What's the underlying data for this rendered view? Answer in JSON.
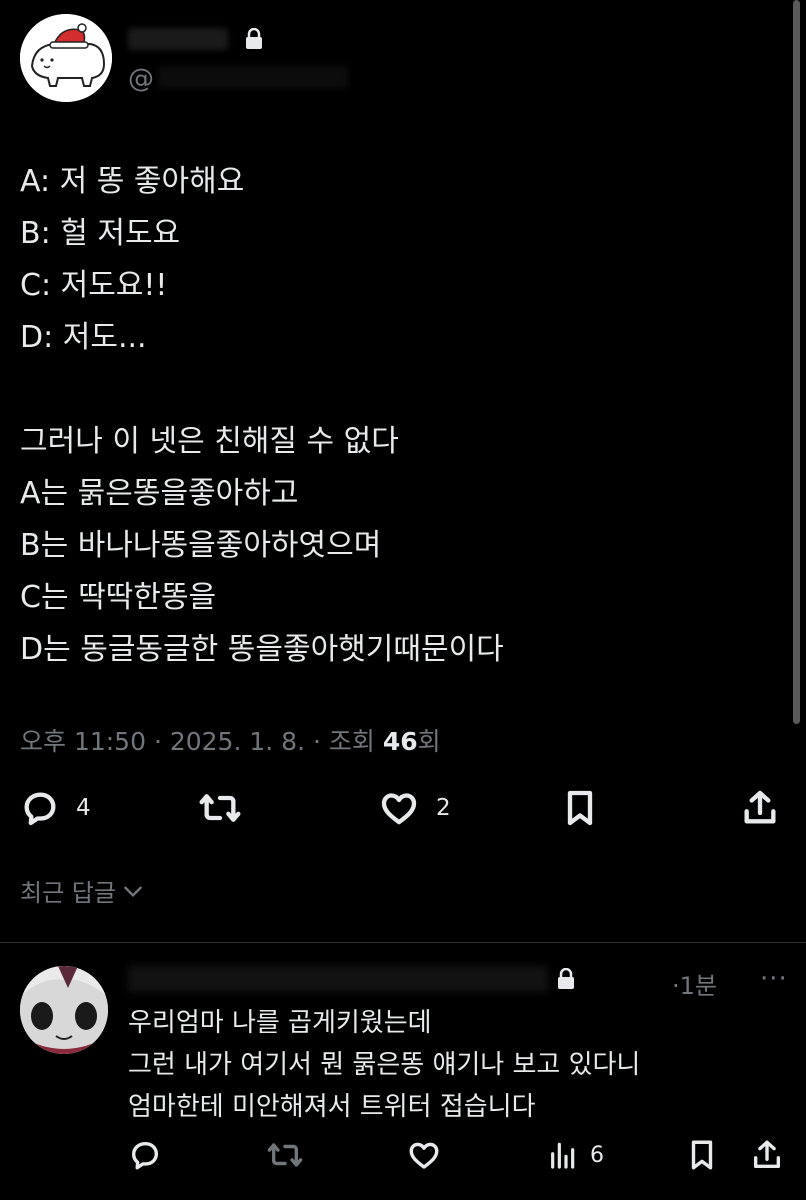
{
  "tweet": {
    "handle_prefix": "@",
    "lines": [
      "A: 저 똥 좋아해요",
      "B: 헐 저도요",
      "C: 저도요!!",
      "D: 저도...",
      "",
      "그러나 이 넷은 친해질 수 없다",
      "A는 묽은똥을좋아하고",
      "B는 바나나똥을좋아하엿으며",
      "C는 딱딱한똥을",
      "D는 동글동글한 똥을좋아햇기때문이다"
    ],
    "meta": {
      "time": "오후 11:50",
      "sep": " · ",
      "date": "2025. 1. 8.",
      "views_prefix": "조회 ",
      "views_count": "46",
      "views_suffix": "회"
    },
    "actions": {
      "reply_count": "4",
      "like_count": "2"
    }
  },
  "replies_sort": {
    "label": "최근 답글"
  },
  "reply": {
    "time": "·1분",
    "more": "···",
    "lines": [
      "우리엄마 나를 곱게키웠는데",
      "그런 내가 여기서 뭔 묽은똥 얘기나 보고 있다니",
      "엄마한테 미안해져서 트위터 접습니다"
    ],
    "actions": {
      "views_count": "6"
    }
  },
  "colors": {
    "background": "#000000",
    "text": "#e7e9ea",
    "secondary": "#71767b",
    "divider": "#2f3336"
  }
}
